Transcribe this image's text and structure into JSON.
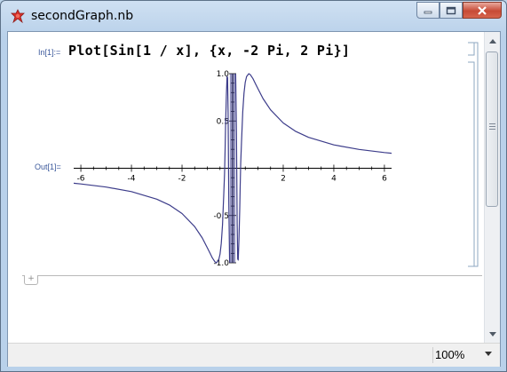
{
  "window": {
    "title": "secondGraph.nb",
    "accent_color": "#c74a36",
    "icon": "mathematica-spikey-icon"
  },
  "notebook": {
    "input_label": "In[1]:=",
    "input_code": "Plot[Sin[1 / x], {x, -2 Pi, 2 Pi}]",
    "output_label": "Out[1]="
  },
  "statusbar": {
    "zoom": "100%"
  },
  "chart_data": {
    "type": "line",
    "title": "",
    "xlabel": "",
    "ylabel": "",
    "function": "Sin[1/x]",
    "xlim": [
      -6.283,
      6.283
    ],
    "ylim": [
      -1.0,
      1.0
    ],
    "x_ticks": [
      "-6",
      "-4",
      "-2",
      "2",
      "4",
      "6"
    ],
    "y_ticks": [
      "-1.0",
      "-0.5",
      "0.5",
      "1.0"
    ],
    "line_color": "#3c3c8a",
    "grid": false,
    "series": [
      {
        "x": [
          -6.283,
          -6,
          -5,
          -4,
          -3,
          -2.5,
          -2,
          -1.5,
          -1.2,
          -1,
          -0.9,
          -0.8,
          -0.7,
          -0.64,
          -0.55,
          -0.5,
          -0.45,
          -0.4,
          -0.35,
          -0.32,
          -0.3,
          -0.28,
          -0.25,
          -0.22,
          -0.2,
          -0.18,
          -0.15,
          -0.12
        ],
        "y": [
          -0.159,
          -0.166,
          -0.199,
          -0.247,
          -0.327,
          -0.389,
          -0.479,
          -0.618,
          -0.737,
          -0.841,
          -0.896,
          -0.949,
          -0.99,
          -1.0,
          -0.97,
          -0.909,
          -0.794,
          -0.598,
          -0.279,
          -0.055,
          0.19,
          0.434,
          0.757,
          0.971,
          0.959,
          0.59,
          -0.375,
          -0.997
        ]
      },
      {
        "x": [
          0.12,
          0.15,
          0.18,
          0.2,
          0.22,
          0.25,
          0.28,
          0.3,
          0.32,
          0.35,
          0.4,
          0.45,
          0.5,
          0.55,
          0.64,
          0.7,
          0.8,
          0.9,
          1,
          1.2,
          1.5,
          2,
          2.5,
          3,
          4,
          5,
          6,
          6.283
        ],
        "y": [
          0.997,
          0.375,
          -0.59,
          -0.959,
          -0.971,
          -0.757,
          -0.434,
          -0.19,
          0.055,
          0.279,
          0.598,
          0.794,
          0.909,
          0.97,
          1.0,
          0.99,
          0.949,
          0.896,
          0.841,
          0.737,
          0.618,
          0.479,
          0.389,
          0.327,
          0.247,
          0.199,
          0.166,
          0.159
        ]
      }
    ]
  }
}
